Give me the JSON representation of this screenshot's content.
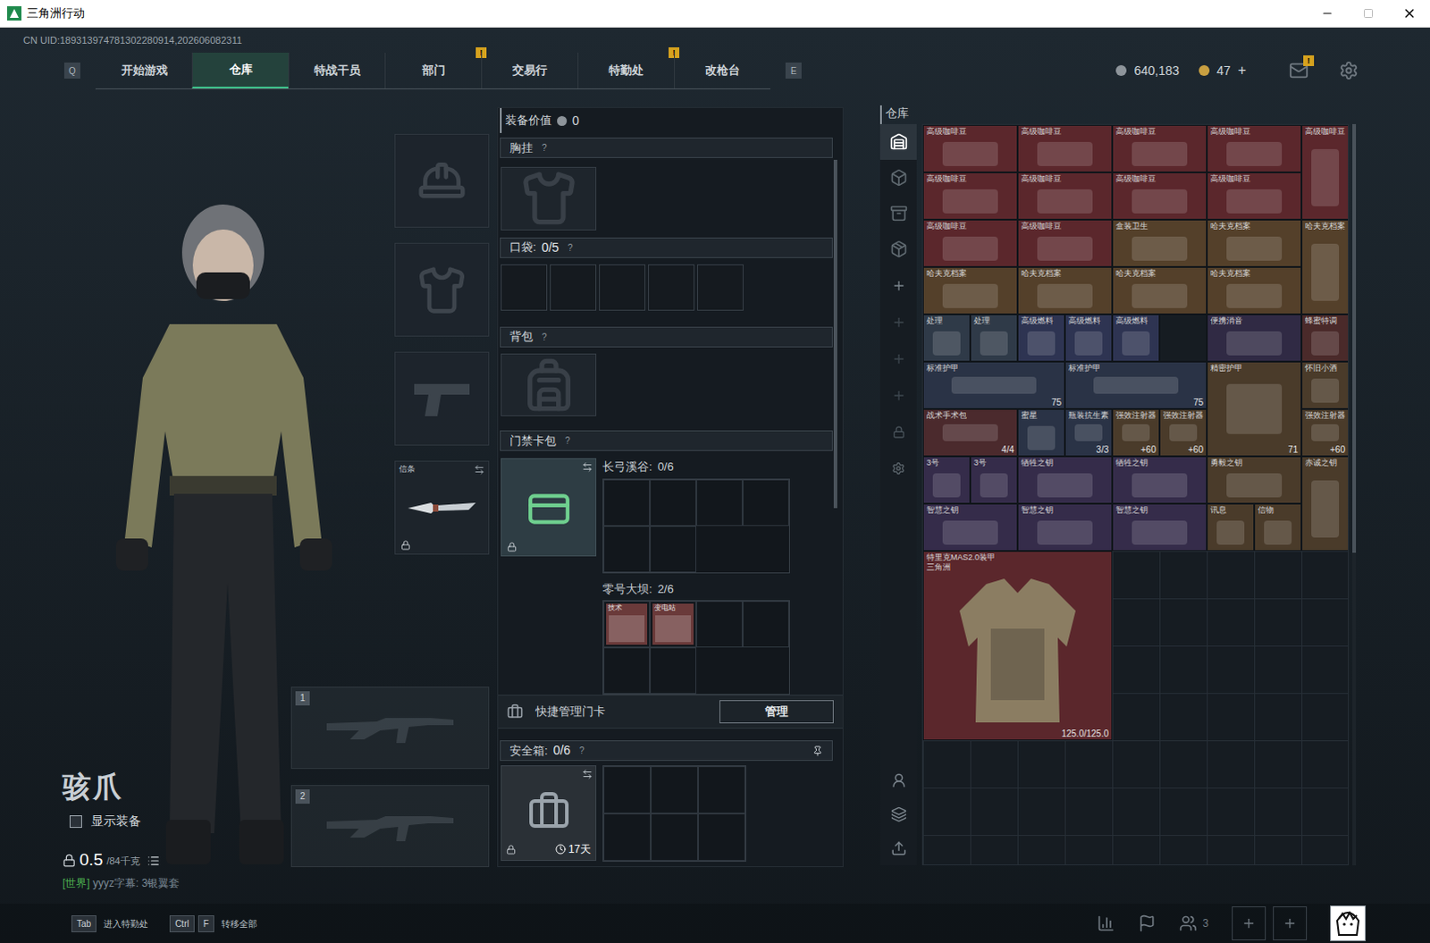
{
  "window": {
    "title": "三角洲行动",
    "uid": "CN UID:189313974781302280914,202606082311"
  },
  "nav": {
    "prev_key": "Q",
    "next_key": "E",
    "tabs": [
      {
        "label": "开始游戏",
        "selected": false
      },
      {
        "label": "仓库",
        "selected": true
      },
      {
        "label": "特战干员",
        "selected": false
      },
      {
        "label": "部门",
        "selected": false,
        "badge": "!"
      },
      {
        "label": "交易行",
        "selected": false
      },
      {
        "label": "特勤处",
        "selected": false,
        "badge": "!"
      },
      {
        "label": "改枪台",
        "selected": false
      }
    ]
  },
  "currency": {
    "coins": "640,183",
    "tickets": "47",
    "add": "+",
    "mail_badge": "!"
  },
  "operator": {
    "name": "骇爪",
    "show_equipment": {
      "label": "显示装备",
      "checked": false
    },
    "weight": "0.5",
    "weight_max": "/84千克",
    "chat": {
      "channel": "[世界]",
      "text": "yyyz字幕: 3银翼套"
    }
  },
  "equipment_slots": [
    {
      "kind": "helmet",
      "locked": false
    },
    {
      "kind": "armor",
      "locked": false
    },
    {
      "kind": "pistol",
      "locked": false
    },
    {
      "kind": "melee",
      "label": "信条",
      "locked": true
    }
  ],
  "weapon_slots": [
    {
      "number": "1"
    },
    {
      "number": "2"
    }
  ],
  "loadout": {
    "value_label": "装备价值",
    "value": "0",
    "chest": {
      "title": "胸挂",
      "help": "?"
    },
    "pockets": {
      "title": "口袋:",
      "count": "0/5",
      "help": "?",
      "slots": 5
    },
    "backpack": {
      "title": "背包",
      "help": "?"
    },
    "keycard": {
      "title": "门禁卡包",
      "help": "?",
      "locked": true,
      "maps": [
        {
          "name": "长弓溪谷:",
          "count": "0/6",
          "slots": 6,
          "cards": []
        },
        {
          "name": "零号大坝:",
          "count": "2/6",
          "slots": 6,
          "cards": [
            "技术",
            "变电站"
          ]
        }
      ]
    },
    "quick_manage": {
      "label": "快捷管理门卡",
      "button": "管理"
    },
    "safe_box": {
      "title": "安全箱:",
      "count": "0/6",
      "help": "?",
      "timer": "17天",
      "locked": true,
      "slots": 6
    }
  },
  "warehouse": {
    "title": "仓库",
    "sidebar_tabs": [
      {
        "selected": true
      },
      {
        "selected": false
      },
      {
        "selected": false
      },
      {
        "selected": false
      }
    ],
    "items": [
      {
        "name": "高级咖啡豆",
        "kind": "wide",
        "color": "#5b272c"
      },
      {
        "name": "高级咖啡豆",
        "kind": "wide",
        "color": "#5b272c"
      },
      {
        "name": "高级咖啡豆",
        "kind": "wide",
        "color": "#5b272c"
      },
      {
        "name": "高级咖啡豆",
        "kind": "wide",
        "color": "#5b272c"
      },
      {
        "name": "高级咖啡豆",
        "kind": "tall",
        "color": "#5b272c"
      },
      {
        "name": "高级咖啡豆",
        "kind": "wide",
        "color": "#5b272c"
      },
      {
        "name": "高级咖啡豆",
        "kind": "wide",
        "color": "#5b272c"
      },
      {
        "name": "高级咖啡豆",
        "kind": "wide",
        "color": "#5b272c"
      },
      {
        "name": "高级咖啡豆",
        "kind": "wide",
        "color": "#5b272c"
      },
      {
        "name": "高级咖啡豆",
        "kind": "wide",
        "color": "#5b272c"
      },
      {
        "name": "高级咖啡豆",
        "kind": "wide",
        "color": "#5b272c"
      },
      {
        "name": "盒装卫生",
        "kind": "wide",
        "color": "#54402a"
      },
      {
        "name": "哈夫克档案",
        "kind": "wide",
        "color": "#54402a"
      },
      {
        "name": "哈夫克档案",
        "kind": "tall",
        "color": "#54402a"
      },
      {
        "name": "哈夫克档案",
        "kind": "wide",
        "color": "#54402a"
      },
      {
        "name": "哈夫克档案",
        "kind": "wide",
        "color": "#54402a"
      },
      {
        "name": "哈夫克档案",
        "kind": "wide",
        "color": "#54402a"
      },
      {
        "name": "哈夫克档案",
        "kind": "wide",
        "color": "#54402a"
      },
      {
        "name": "处理",
        "kind": "small",
        "color": "#2f3a48"
      },
      {
        "name": "处理",
        "kind": "small",
        "color": "#2f3a48"
      },
      {
        "name": "高级燃料",
        "kind": "small",
        "color": "#2e3452"
      },
      {
        "name": "高级燃料",
        "kind": "small",
        "color": "#2e3452"
      },
      {
        "name": "高级燃料",
        "kind": "small",
        "color": "#2e3452"
      },
      {
        "name": "",
        "kind": "empty"
      },
      {
        "name": "便携消音",
        "kind": "wide",
        "color": "#302a44"
      },
      {
        "name": "蜂蜜特调",
        "kind": "small",
        "color": "#4a2a2a"
      },
      {
        "name": "标准护甲",
        "kind": "long",
        "color": "#2a3346",
        "badge": "75"
      },
      {
        "name": "标准护甲",
        "kind": "long",
        "color": "#2a3346",
        "badge": "75"
      },
      {
        "name": "精密护甲",
        "kind": "square",
        "color": "#4a3b2a",
        "badge": "71"
      },
      {
        "name": "怀旧小酒",
        "kind": "small",
        "color": "#4a3b2a"
      },
      {
        "name": "战术手术包",
        "kind": "wide",
        "color": "#4b2a2d",
        "badge": "4/4"
      },
      {
        "name": "蜜星",
        "kind": "small",
        "color": "#2a3346"
      },
      {
        "name": "瓶装抗生素",
        "kind": "small",
        "color": "#2a3346",
        "badge": "3/3"
      },
      {
        "name": "强效注射器",
        "kind": "small",
        "color": "#4a3b2a",
        "badge": "+60"
      },
      {
        "name": "强效注射器",
        "kind": "small",
        "color": "#4a3b2a",
        "badge": "+60"
      },
      {
        "name": "强效注射器",
        "kind": "small",
        "color": "#4a3b2a",
        "badge": "+60"
      },
      {
        "name": "3号",
        "kind": "small",
        "color": "#352c4a"
      },
      {
        "name": "3号",
        "kind": "small",
        "color": "#352c4a"
      },
      {
        "name": "牺牲之钥",
        "kind": "wide",
        "color": "#352c4a"
      },
      {
        "name": "牺牲之钥",
        "kind": "wide",
        "color": "#352c4a"
      },
      {
        "name": "勇毅之钥",
        "kind": "wide",
        "color": "#4a3b2a"
      },
      {
        "name": "赤诚之钥",
        "kind": "tall",
        "color": "#4a3b2a"
      },
      {
        "name": "智慧之钥",
        "kind": "wide",
        "color": "#352c4a"
      },
      {
        "name": "智慧之钥",
        "kind": "wide",
        "color": "#352c4a"
      },
      {
        "name": "智慧之钥",
        "kind": "wide",
        "color": "#352c4a"
      },
      {
        "name": "讯息",
        "kind": "small",
        "color": "#4a3b2a"
      },
      {
        "name": "信物",
        "kind": "small",
        "color": "#4a3b2a"
      },
      {
        "name": "特里克MAS2.0装甲",
        "sub": "三角洲",
        "kind": "huge",
        "color": "#5b272c",
        "badge": "125.0/125.0"
      }
    ]
  },
  "hints": [
    {
      "keys": [
        "Tab"
      ],
      "label": "进入特勤处"
    },
    {
      "keys": [
        "Ctrl",
        "F"
      ],
      "label": "转移全部"
    }
  ],
  "social": {
    "friends": "3"
  }
}
